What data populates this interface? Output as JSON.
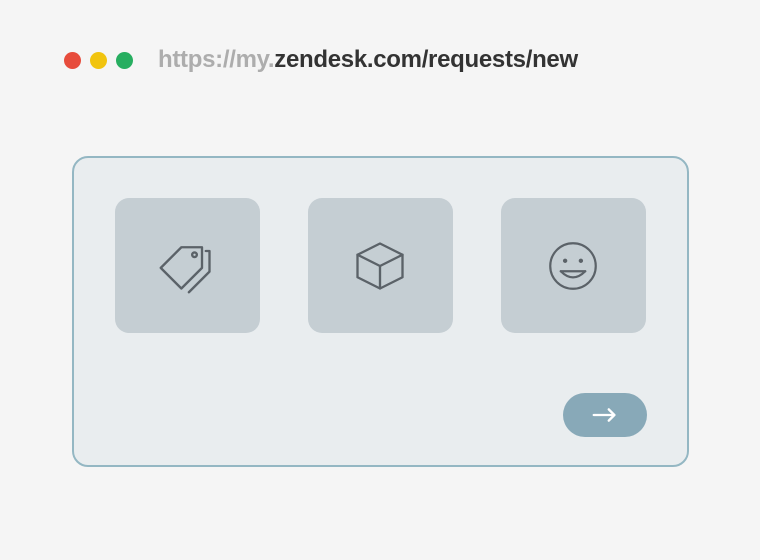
{
  "url": {
    "prefix": "https://my.",
    "path": "zendesk.com/requests/new"
  },
  "options": [
    {
      "icon": "tags-icon"
    },
    {
      "icon": "cube-icon"
    },
    {
      "icon": "smile-icon"
    }
  ],
  "actions": {
    "next": {
      "icon": "arrow-right-icon"
    }
  }
}
